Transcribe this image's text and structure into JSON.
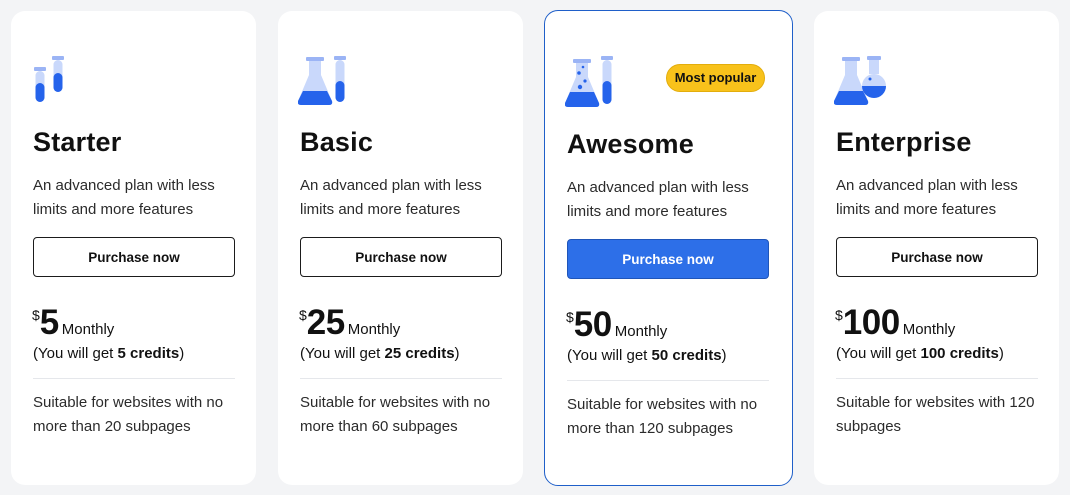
{
  "colors": {
    "accent": "#2d6fe8",
    "icon_blue": "#2563eb",
    "badge": "#f8c21b",
    "featured_border": "#1f5fc9"
  },
  "plans": [
    {
      "icon": "test-tubes-icon",
      "name": "Starter",
      "description": "An advanced plan with less limits and more features",
      "button_label": "Purchase now",
      "currency": "$",
      "price": "5",
      "period": "Monthly",
      "credits_prefix": "(You will get ",
      "credits_value": "5 credits",
      "credits_suffix": ")",
      "suitability": "Suitable for websites with no more than 20 subpages"
    },
    {
      "icon": "flask-tube-icon",
      "name": "Basic",
      "description": "An advanced plan with less limits and more features",
      "button_label": "Purchase now",
      "currency": "$",
      "price": "25",
      "period": "Monthly",
      "credits_prefix": "(You will get ",
      "credits_value": "25 credits",
      "credits_suffix": ")",
      "suitability": "Suitable for websites with no more than 60 subpages"
    },
    {
      "icon": "bubbling-flask-icon",
      "name": "Awesome",
      "badge": "Most popular",
      "description": "An advanced plan with less limits and more features",
      "button_label": "Purchase now",
      "currency": "$",
      "price": "50",
      "period": "Monthly",
      "credits_prefix": "(You will get ",
      "credits_value": "50 credits",
      "credits_suffix": ")",
      "suitability": "Suitable for websites with no more than 120 subpages"
    },
    {
      "icon": "lab-flasks-icon",
      "name": "Enterprise",
      "description": "An advanced plan with less limits and more features",
      "button_label": "Purchase now",
      "currency": "$",
      "price": "100",
      "period": "Monthly",
      "credits_prefix": "(You will get ",
      "credits_value": "100 credits",
      "credits_suffix": ")",
      "suitability": "Suitable for websites with 120 subpages"
    }
  ]
}
